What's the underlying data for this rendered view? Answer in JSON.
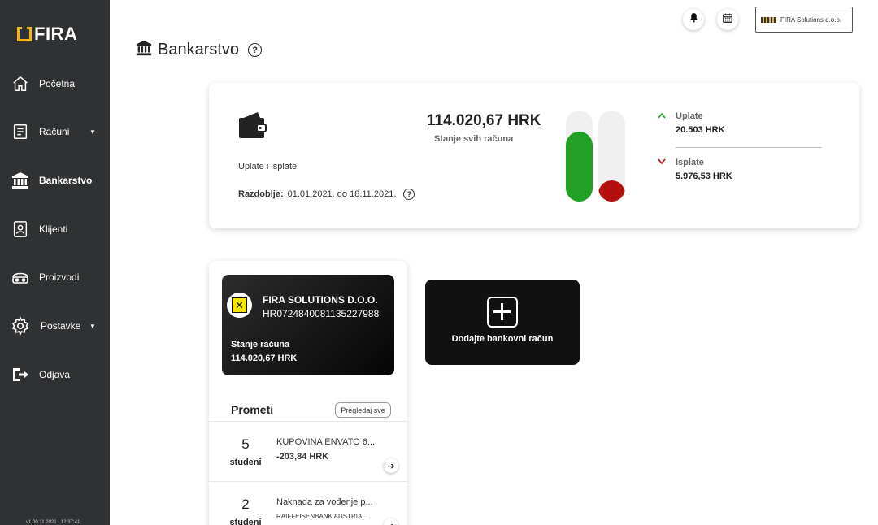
{
  "app": {
    "logo_text": "FIRA"
  },
  "sidebar": {
    "items": [
      {
        "label": "Početna"
      },
      {
        "label": "Računi"
      },
      {
        "label": "Bankarstvo"
      },
      {
        "label": "Klijenti"
      },
      {
        "label": "Proizvodi"
      },
      {
        "label": "Postavke"
      },
      {
        "label": "Odjava"
      }
    ],
    "version": "v1.00.11.2021 - 12:37:41"
  },
  "topbar": {
    "company_name": "FIRA Solutions d.o.o."
  },
  "page": {
    "title": "Bankarstvo",
    "help": "?"
  },
  "summary": {
    "subtitle": "Uplate i isplate",
    "period_label": "Razdoblje:",
    "period_value": "01.01.2021. do 18.11.2021.",
    "total_amount": "114.020,67 HRK",
    "total_caption": "Stanje svih računa",
    "payments_in": {
      "label": "Uplate",
      "value": "20.503 HRK",
      "fraction": 0.77,
      "color": "#21a025"
    },
    "payments_out": {
      "label": "Isplate",
      "value": "5.976,53 HRK",
      "fraction": 0.23,
      "color": "#b30f0f"
    }
  },
  "account": {
    "company": "FIRA SOLUTIONS D.O.O.",
    "iban": "HR0724840081135227988",
    "balance_label": "Stanje računa",
    "balance": "114.020,67 HRK"
  },
  "transactions": {
    "title": "Prometi",
    "view_all": "Pregledaj sve",
    "rows": [
      {
        "day": "5",
        "month": "studeni",
        "description": "KUPOVINA ENVATO 6...",
        "amount": "-203,84 HRK"
      },
      {
        "day": "2",
        "month": "studeni",
        "description": "Naknada za vođenje p...",
        "sub": "RAIFFEISENBANK AUSTRIA..."
      }
    ]
  },
  "add_account": {
    "label": "Dodajte bankovni račun"
  }
}
